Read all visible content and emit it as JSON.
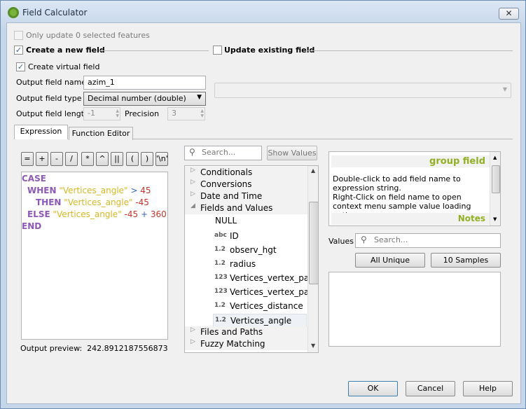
{
  "window": {
    "title": "Field Calculator",
    "close_icon": "close-icon"
  },
  "options": {
    "only_update": "Only update 0 selected features",
    "create_new": "Create a new field",
    "create_new_checked": true,
    "update_existing": "Update existing field",
    "update_existing_checked": false,
    "create_virtual": "Create virtual field",
    "create_virtual_checked": true,
    "name_label": "Output field name",
    "name_value": "azim_1",
    "type_label": "Output field type",
    "type_value": "Decimal number (double)",
    "length_label": "Output field length",
    "length_value": "-1",
    "precision_label": "Precision",
    "precision_value": "3"
  },
  "tabs": [
    {
      "label": "Expression",
      "active": true
    },
    {
      "label": "Function Editor",
      "active": false
    }
  ],
  "operators": [
    "=",
    "+",
    "-",
    "/",
    "*",
    "^",
    "||",
    "(",
    ")",
    "'\\n'"
  ],
  "expression": {
    "lines": [
      [
        {
          "t": "CASE",
          "c": "kw"
        }
      ],
      [
        {
          "t": "WHEN",
          "c": "kw"
        },
        {
          "t": "\"Vertices_angle\"",
          "c": "str"
        },
        {
          "t": ">",
          "c": "opc"
        },
        {
          "t": "45",
          "c": "num"
        }
      ],
      [
        {
          "t": "THEN",
          "c": "kw"
        },
        {
          "t": "\"Vertices_angle\"",
          "c": "str"
        },
        {
          "t": "-45",
          "c": "num"
        }
      ],
      [
        {
          "t": "ELSE",
          "c": "kw"
        },
        {
          "t": "\"Vertices_angle\"",
          "c": "str"
        },
        {
          "t": "-45",
          "c": "num"
        },
        {
          "t": "+",
          "c": "opc"
        },
        {
          "t": "360",
          "c": "num"
        }
      ],
      [
        {
          "t": "END",
          "c": "kw"
        }
      ]
    ],
    "preview_label": "Output preview:",
    "preview_value": "242.8912187556873"
  },
  "functions": {
    "search_placeholder": "Search...",
    "show_values": "Show Values",
    "groups_before": [
      "Conditionals",
      "Conversions",
      "Date and Time"
    ],
    "expanded_group": "Fields and Values",
    "fields": [
      {
        "type": "",
        "name": "NULL"
      },
      {
        "type": "abc",
        "name": "ID"
      },
      {
        "type": "1.2",
        "name": "observ_hgt"
      },
      {
        "type": "1.2",
        "name": "radius"
      },
      {
        "type": "123",
        "name": "Vertices_vertex_part"
      },
      {
        "type": "123",
        "name": "Vertices_vertex_pa..."
      },
      {
        "type": "1.2",
        "name": "Vertices_distance"
      },
      {
        "type": "1.2",
        "name": "Vertices_angle",
        "selected": true
      }
    ],
    "groups_after": [
      "Files and Paths",
      "Fuzzy Matching"
    ]
  },
  "help": {
    "heading": "group field",
    "text1": "Double-click to add field name to expression string.",
    "text2": "Right-Click on field name to open context menu sample value loading options.",
    "notes": "Notes",
    "heading_color": "#93b023"
  },
  "values": {
    "label": "Values",
    "search_placeholder": "Search...",
    "all_unique": "All Unique",
    "samples": "10 Samples"
  },
  "buttons": {
    "ok": "OK",
    "cancel": "Cancel",
    "help": "Help"
  }
}
